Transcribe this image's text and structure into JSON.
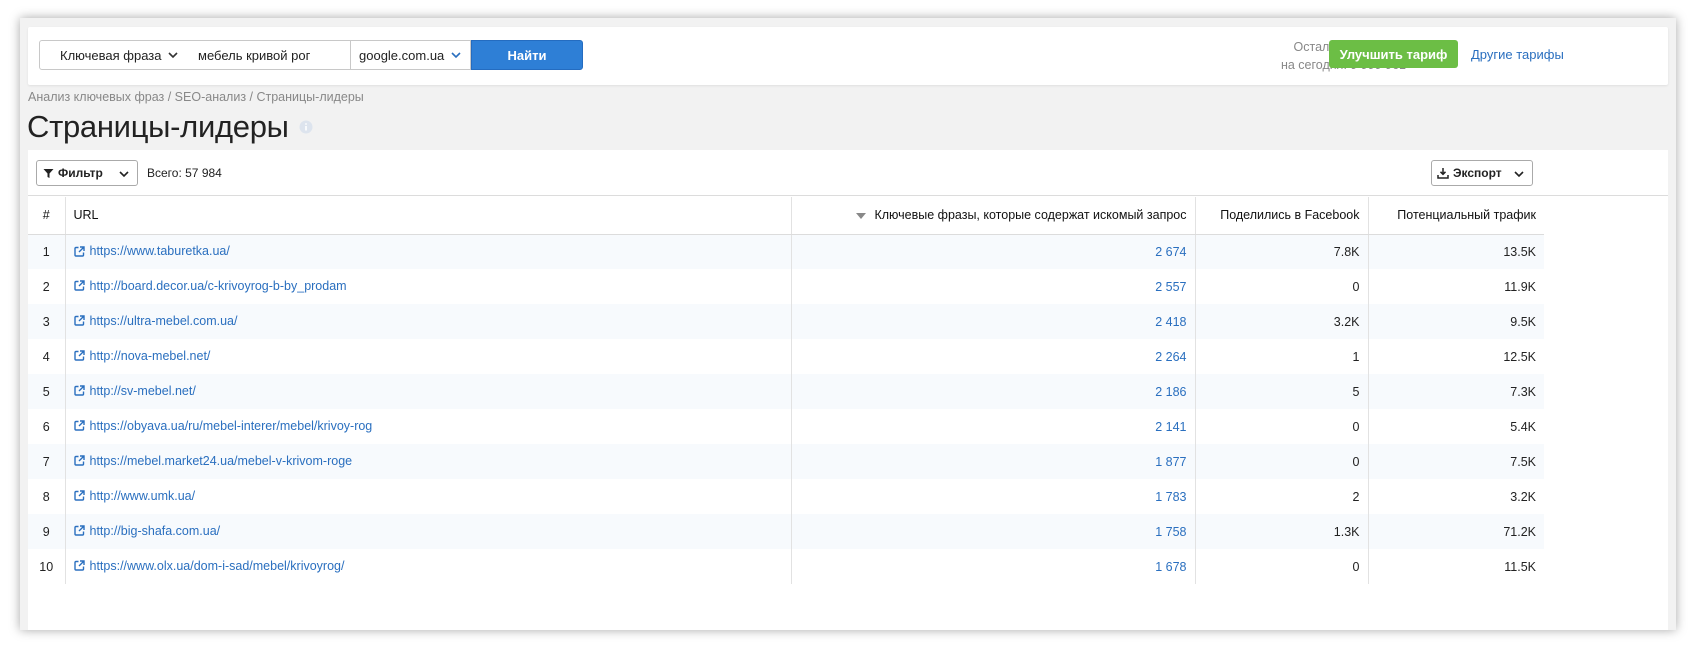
{
  "search": {
    "type_label": "Ключевая фраза",
    "query": "мебель кривой рог",
    "engine": "google.com.ua",
    "find_label": "Найти"
  },
  "quota": {
    "line1": "Осталось запросов",
    "line2": "на сегодня: 9 999 961"
  },
  "upgrade_label": "Улучшить тариф",
  "other_tariffs_label": "Другие тарифы",
  "breadcrumb": "Анализ ключевых фраз / SEO-анализ / Страницы-лидеры",
  "page_title": "Страницы-лидеры",
  "toolbar": {
    "filter_label": "Фильтр",
    "total": "Всего: 57 984",
    "export_label": "Экспорт"
  },
  "table": {
    "headers": {
      "num": "#",
      "url": "URL",
      "keywords": "Ключевые фразы, которые содержат искомый запрос",
      "facebook": "Поделились в Facebook",
      "traffic": "Потенциальный трафик"
    },
    "rows": [
      {
        "num": "1",
        "url": "https://www.taburetka.ua/",
        "keywords": "2 674",
        "facebook": "7.8K",
        "traffic": "13.5K"
      },
      {
        "num": "2",
        "url": "http://board.decor.ua/c-krivoyrog-b-by_prodam",
        "keywords": "2 557",
        "facebook": "0",
        "traffic": "11.9K"
      },
      {
        "num": "3",
        "url": "https://ultra-mebel.com.ua/",
        "keywords": "2 418",
        "facebook": "3.2K",
        "traffic": "9.5K"
      },
      {
        "num": "4",
        "url": "http://nova-mebel.net/",
        "keywords": "2 264",
        "facebook": "1",
        "traffic": "12.5K"
      },
      {
        "num": "5",
        "url": "http://sv-mebel.net/",
        "keywords": "2 186",
        "facebook": "5",
        "traffic": "7.3K"
      },
      {
        "num": "6",
        "url": "https://obyava.ua/ru/mebel-interer/mebel/krivoy-rog",
        "keywords": "2 141",
        "facebook": "0",
        "traffic": "5.4K"
      },
      {
        "num": "7",
        "url": "https://mebel.market24.ua/mebel-v-krivom-roge",
        "keywords": "1 877",
        "facebook": "0",
        "traffic": "7.5K"
      },
      {
        "num": "8",
        "url": "http://www.umk.ua/",
        "keywords": "1 783",
        "facebook": "2",
        "traffic": "3.2K"
      },
      {
        "num": "9",
        "url": "http://big-shafa.com.ua/",
        "keywords": "1 758",
        "facebook": "1.3K",
        "traffic": "71.2K"
      },
      {
        "num": "10",
        "url": "https://www.olx.ua/dom-i-sad/mebel/krivoyrog/",
        "keywords": "1 678",
        "facebook": "0",
        "traffic": "11.5K"
      }
    ]
  },
  "colors": {
    "accent_blue": "#2e7fd6",
    "link_blue": "#2a6fbf",
    "upgrade_green": "#6cbe45"
  },
  "icons": {
    "chevron": "chevron-down-icon",
    "filter": "filter-icon",
    "export": "download-icon",
    "link": "external-link-icon",
    "info": "info-icon",
    "sort": "sort-desc-icon"
  }
}
